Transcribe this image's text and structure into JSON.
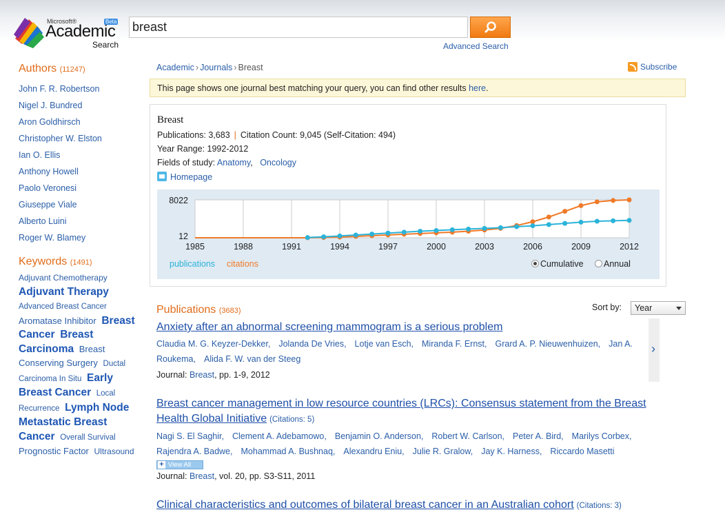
{
  "logo": {
    "microsoft": "Microsoft®",
    "academic": "Academic",
    "search": "Search",
    "beta": "Beta"
  },
  "search": {
    "value": "breast",
    "advanced_label": "Advanced Search"
  },
  "authors": {
    "title": "Authors",
    "count": "(11247)",
    "items": [
      "John F. R. Robertson",
      "Nigel J. Bundred",
      "Aron Goldhirsch",
      "Christopher W. Elston",
      "Ian O. Ellis",
      "Anthony Howell",
      "Paolo Veronesi",
      "Giuseppe Viale",
      "Alberto Luini",
      "Roger W. Blamey"
    ]
  },
  "keywords": {
    "title": "Keywords",
    "count": "(1491)",
    "items": [
      {
        "text": "Adjuvant Chemotherapy",
        "size": "s"
      },
      {
        "text": "Adjuvant Therapy",
        "size": "l"
      },
      {
        "text": "Advanced Breast Cancer",
        "size": "xs"
      },
      {
        "text": "Aromatase Inhibitor",
        "size": "m"
      },
      {
        "text": "Breast Cancer",
        "size": "l"
      },
      {
        "text": "Breast Carcinoma",
        "size": "l"
      },
      {
        "text": "Breast Conserving Surgery",
        "size": "m"
      },
      {
        "text": "Ductal Carcinoma In Situ",
        "size": "xs"
      },
      {
        "text": "Early Breast Cancer",
        "size": "l"
      },
      {
        "text": "Local Recurrence",
        "size": "xs"
      },
      {
        "text": "Lymph Node",
        "size": "l"
      },
      {
        "text": "Metastatic Breast Cancer",
        "size": "l"
      },
      {
        "text": "Overall Survival",
        "size": "xs"
      },
      {
        "text": "Prognostic Factor",
        "size": "m"
      },
      {
        "text": "Ultrasound",
        "size": "s"
      }
    ]
  },
  "breadcrumb": {
    "academic": "Academic",
    "journals": "Journals",
    "current": "Breast",
    "sep": "›"
  },
  "subscribe": "Subscribe",
  "notice": {
    "text": "This page shows one journal best matching your query, you can find other results ",
    "link": "here",
    "end": "."
  },
  "journal": {
    "title": "Breast",
    "publications_label": "Publications:",
    "publications": "3,683",
    "pipe": "|",
    "citations_label": "Citation Count:",
    "citations": "9,045",
    "self_citation": "(Self-Citation: 494)",
    "year_range_label": "Year Range:",
    "year_range": "1992-2012",
    "fields_label": "Fields of study:",
    "fields": [
      "Anatomy",
      "Oncology"
    ],
    "homepage": "Homepage"
  },
  "chart_data": {
    "type": "line",
    "x": [
      1985,
      1986,
      1987,
      1988,
      1989,
      1990,
      1991,
      1992,
      1993,
      1994,
      1995,
      1996,
      1997,
      1998,
      1999,
      2000,
      2001,
      2002,
      2003,
      2004,
      2005,
      2006,
      2007,
      2008,
      2009,
      2010,
      2011,
      2012
    ],
    "x_ticks": [
      1985,
      1988,
      1991,
      1994,
      1997,
      2000,
      2003,
      2006,
      2009,
      2012
    ],
    "y_ticks": [
      "8022",
      "12"
    ],
    "ylim": [
      12,
      8022
    ],
    "series": [
      {
        "name": "publications",
        "color": "#2bb3d9",
        "first_x": 1992,
        "values": [
          60,
          220,
          400,
          600,
          800,
          1000,
          1200,
          1400,
          1550,
          1700,
          1850,
          2000,
          2150,
          2350,
          2550,
          2800,
          3050,
          3300,
          3500,
          3600,
          3683
        ]
      },
      {
        "name": "citations",
        "color": "#f07a28",
        "first_x": 1985,
        "values": [
          12,
          12,
          12,
          12,
          12,
          12,
          12,
          20,
          60,
          150,
          300,
          450,
          600,
          750,
          900,
          1050,
          1200,
          1400,
          1650,
          2000,
          2600,
          3400,
          4400,
          5600,
          6800,
          7600,
          7900,
          8022
        ]
      }
    ],
    "legend": [
      "publications",
      "citations"
    ],
    "mode_options": [
      "Cumulative",
      "Annual"
    ],
    "mode_selected": "Cumulative"
  },
  "publications": {
    "title": "Publications",
    "count": "(3683)",
    "sort_label": "Sort by:",
    "sort_value": "Year",
    "journal_label": "Journal:",
    "view_all": "View All",
    "items": [
      {
        "title": "Anxiety after an abnormal screening mammogram is a serious problem",
        "citations": "",
        "authors_line1": [
          "Claudia M. G. Keyzer-Dekker,",
          "Jolanda De Vries,",
          "Lotje van Esch,",
          "Miranda F. Ernst,",
          "Grard A. P. Nieuwenhuizen,",
          "Jan A."
        ],
        "authors_line2": [
          "Roukema,",
          "Alida F. W. van der Steeg"
        ],
        "journal": "Breast",
        "details": ", pp. 1-9, 2012"
      },
      {
        "title_line1": "Breast cancer management in low resource countries (LRCs): Consensus statement from the Breast",
        "title_line2": "Health Global Initiative",
        "citations": "(Citations: 5)",
        "authors_line1": [
          "Nagi S. El Saghir,",
          "Clement A. Adebamowo,",
          "Benjamin O. Anderson,",
          "Robert W. Carlson,",
          "Peter A. Bird,",
          "Marilys Corbex,"
        ],
        "authors_line2": [
          "Rajendra A. Badwe,",
          "Mohammad A. Bushnaq,",
          "Alexandru Eniu,",
          "Julie R. Gralow,",
          "Jay K. Harness,",
          "Riccardo Masetti"
        ],
        "journal": "Breast",
        "details": ", vol. 20, pp. S3-S11, 2011"
      },
      {
        "title": "Clinical characteristics and outcomes of bilateral breast cancer in an Australian cohort",
        "citations": "(Citations: 3)"
      }
    ]
  }
}
